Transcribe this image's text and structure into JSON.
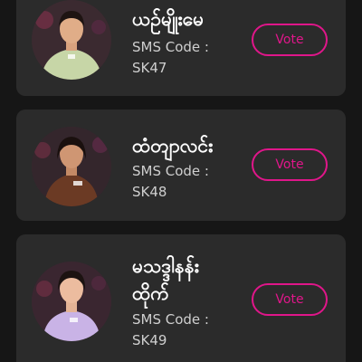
{
  "contestants": [
    {
      "name": "ယဉ်မျိုးမေ",
      "sms_label": "SMS Code :",
      "sms_code": "SK47",
      "vote_label": "Vote",
      "dress_color": "#c7d6a7"
    },
    {
      "name": "ထံတျာလင်း",
      "sms_label": "SMS Code :",
      "sms_code": "SK48",
      "vote_label": "Vote",
      "dress_color": "#6b3a24"
    },
    {
      "name": "မသဒ္ဒါနန်း\nထိုက်",
      "sms_label": "SMS Code :",
      "sms_code": "SK49",
      "vote_label": "Vote",
      "dress_color": "#c9b3e6"
    }
  ],
  "colors": {
    "accent": "#e0168a",
    "card_bg": "#2b2b2b",
    "page_bg": "#161616"
  }
}
